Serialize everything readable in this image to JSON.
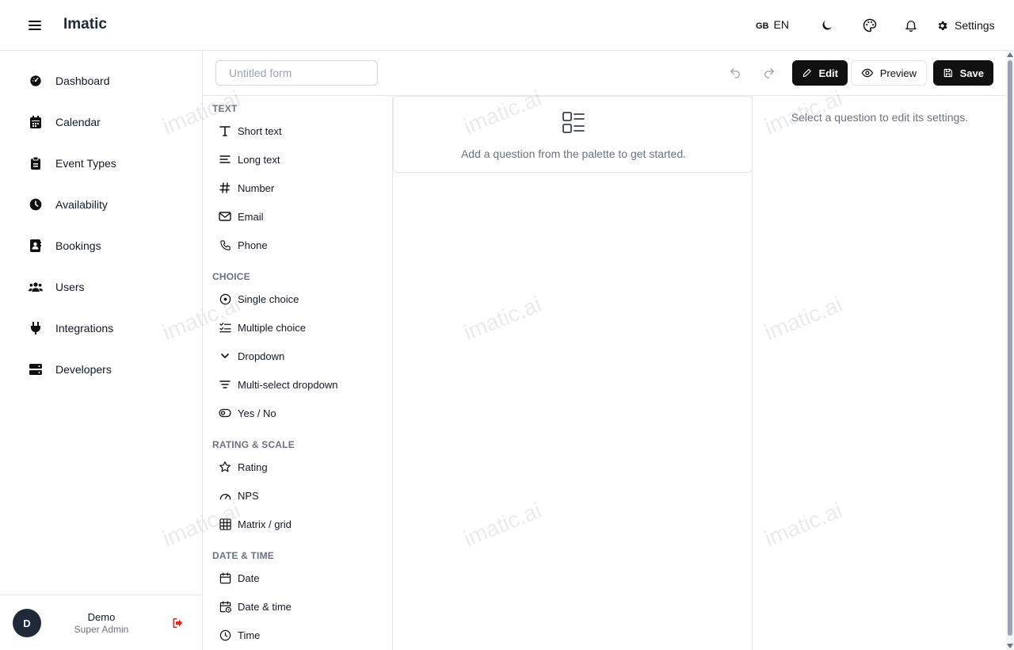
{
  "app": {
    "brand": "Imatic"
  },
  "topbar": {
    "lang_flag": "GB",
    "lang_code": "EN",
    "settings_label": "Settings"
  },
  "sidebar": {
    "items": [
      {
        "label": "Dashboard",
        "icon": "dashboard-icon"
      },
      {
        "label": "Calendar",
        "icon": "calendar-icon"
      },
      {
        "label": "Event Types",
        "icon": "clipboard-icon"
      },
      {
        "label": "Availability",
        "icon": "clock-icon"
      },
      {
        "label": "Bookings",
        "icon": "address-book-icon"
      },
      {
        "label": "Users",
        "icon": "users-icon"
      },
      {
        "label": "Integrations",
        "icon": "plug-icon"
      },
      {
        "label": "Developers",
        "icon": "server-icon"
      }
    ],
    "user": {
      "initial": "D",
      "name": "Demo",
      "role": "Super Admin"
    }
  },
  "builder": {
    "title_placeholder": "Untitled form",
    "edit_label": "Edit",
    "preview_label": "Preview",
    "save_label": "Save"
  },
  "palette": {
    "categories": [
      {
        "name": "TEXT",
        "items": [
          "Short text",
          "Long text",
          "Number",
          "Email",
          "Phone"
        ]
      },
      {
        "name": "CHOICE",
        "items": [
          "Single choice",
          "Multiple choice",
          "Dropdown",
          "Multi-select dropdown",
          "Yes / No"
        ]
      },
      {
        "name": "RATING & SCALE",
        "items": [
          "Rating",
          "NPS",
          "Matrix / grid"
        ]
      },
      {
        "name": "DATE & TIME",
        "items": [
          "Date",
          "Date & time",
          "Time"
        ]
      }
    ]
  },
  "canvas": {
    "empty_text": "Add a question from the palette to get started."
  },
  "settings_panel": {
    "hint": "Select a question to edit its settings."
  },
  "watermark": "imatic.ai",
  "colors": {
    "primary": "#111111",
    "border": "#e5e7eb",
    "muted": "#6b7280",
    "logout": "#dc2626"
  }
}
